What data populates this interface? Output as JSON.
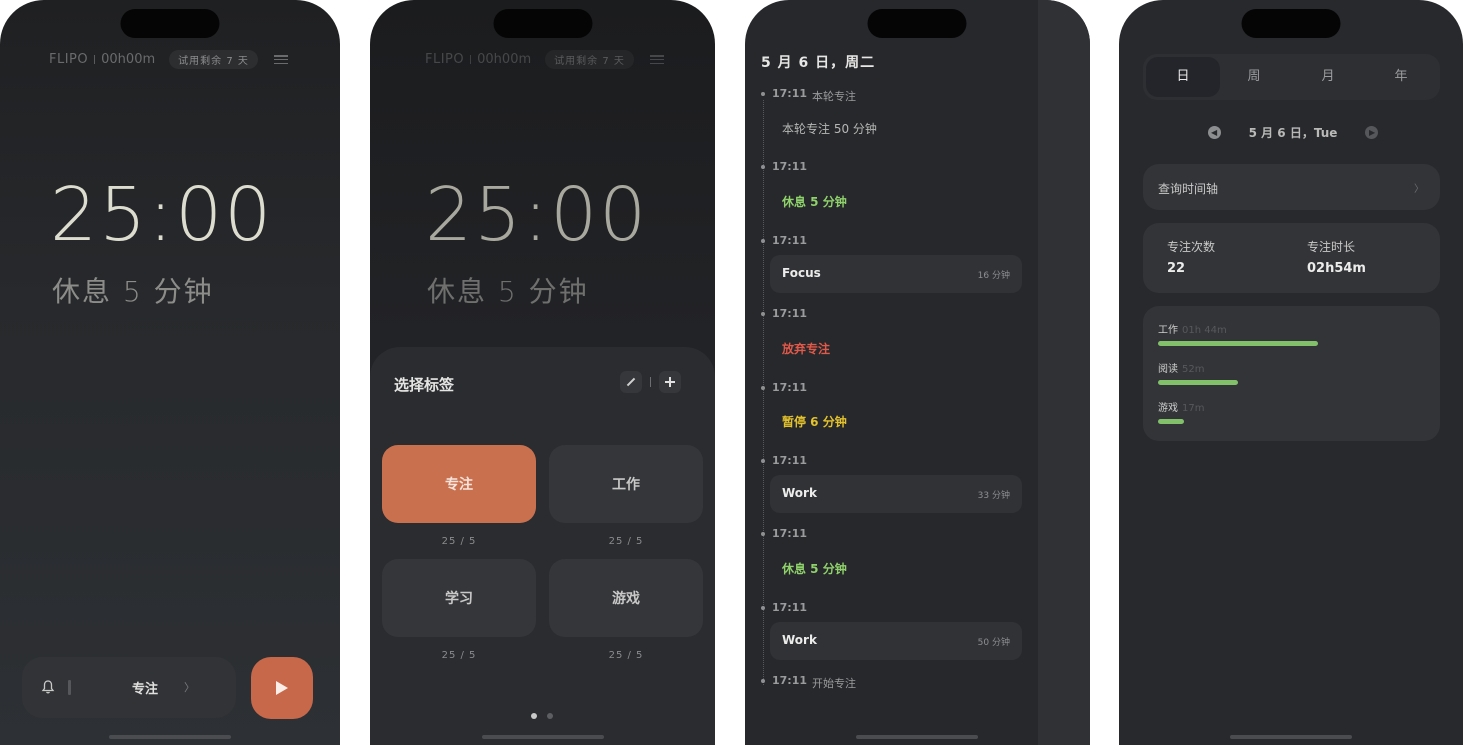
{
  "phone1": {
    "brand": "FLIPO",
    "elapsed": "00h00m",
    "trial": "试用剩余 7 天",
    "timer": "25:00",
    "mode": "休息 5 分钟",
    "bottom_label": "专注",
    "bottom_chevron": "〉"
  },
  "phone2": {
    "brand": "FLIPO",
    "elapsed": "00h00m",
    "trial": "试用剩余 7 天",
    "timer": "25:00",
    "mode": "休息 5 分钟",
    "sheet_title": "选择标签",
    "tags": [
      {
        "name": "专注",
        "sub": "25 / 5"
      },
      {
        "name": "工作",
        "sub": "25 / 5"
      },
      {
        "name": "学习",
        "sub": "25 / 5"
      },
      {
        "name": "游戏",
        "sub": "25 / 5"
      }
    ]
  },
  "phone3": {
    "date": "5 月 6 日，周二",
    "events": [
      {
        "time": "17:11",
        "note": "本轮专注",
        "text": "本轮专注 50 分钟",
        "color": "#b6b7b5"
      },
      {
        "time": "17:11",
        "text": "休息 5 分钟",
        "color": "#8fd16b"
      },
      {
        "time": "17:11",
        "card_name": "Focus",
        "card_dur": "16 分钟"
      },
      {
        "time": "17:11",
        "text": "放弃专注",
        "color": "#e0594a"
      },
      {
        "time": "17:11",
        "text": "暂停 6 分钟",
        "color": "#e3c22c"
      },
      {
        "time": "17:11",
        "card_name": "Work",
        "card_dur": "33 分钟"
      },
      {
        "time": "17:11",
        "text": "休息 5 分钟",
        "color": "#8fd16b"
      },
      {
        "time": "17:11",
        "card_name": "Work",
        "card_dur": "50 分钟"
      },
      {
        "time": "17:11",
        "note": "开始专注"
      }
    ]
  },
  "phone4": {
    "segments": [
      "日",
      "周",
      "月",
      "年"
    ],
    "date": "5 月 6 日，Tue",
    "query_label": "查询时间轴",
    "query_chevron": "〉",
    "focus_count_label": "专注次数",
    "focus_count": "22",
    "focus_duration_label": "专注时长",
    "focus_duration": "02h54m",
    "categories": [
      {
        "name": "工作",
        "value": "01h 44m",
        "minutes": 104
      },
      {
        "name": "阅读",
        "value": "52m",
        "minutes": 52
      },
      {
        "name": "游戏",
        "value": "17m",
        "minutes": 17
      }
    ],
    "bar_color": "#82c16a"
  }
}
